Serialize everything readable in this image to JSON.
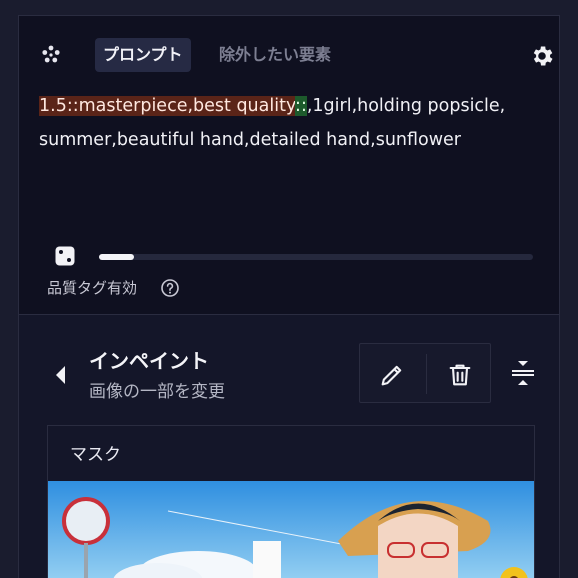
{
  "prompt_panel": {
    "tabs": [
      {
        "label": "プロンプト",
        "active": true
      },
      {
        "label": "除外したい要素",
        "active": false
      }
    ],
    "prompt_segments": [
      {
        "text": "1.5::masterpiece,best quality",
        "highlight": "red"
      },
      {
        "text": "::",
        "highlight": "green"
      },
      {
        "text": ",1girl,holding popsicle, summer,beautiful hand,detailed hand,sunflower",
        "highlight": "none"
      }
    ],
    "slider_level": 0.08,
    "quality_tag_label": "品質タグ有効",
    "icons": {
      "tab_icon": "flower-icon",
      "settings": "gear-icon",
      "random": "dice-icon",
      "help": "help-circle-icon"
    }
  },
  "inpaint_panel": {
    "title": "インペイント",
    "subtitle": "画像の一部を変更",
    "tools": [
      "pencil-icon",
      "trash-icon"
    ],
    "collapse_icon": "collapse-vertical-icon",
    "back_icon": "chevron-left-icon",
    "mask_label": "マスク"
  },
  "colors": {
    "background": "#1a1c2e",
    "panel": "#0f1020",
    "highlight_red": "#5a2418",
    "highlight_green": "#1d5a2c",
    "active_tab": "#262a44"
  }
}
